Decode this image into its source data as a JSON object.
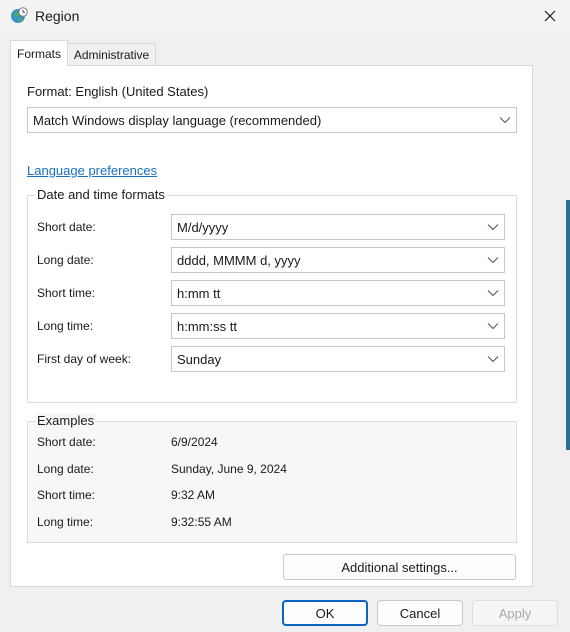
{
  "window": {
    "title": "Region"
  },
  "tabs": [
    {
      "label": "Formats",
      "active": true
    },
    {
      "label": "Administrative",
      "active": false
    }
  ],
  "format": {
    "label": "Format: English (United States)",
    "selected": "Match Windows display language (recommended)"
  },
  "language_link": "Language preferences",
  "date_time": {
    "group_title": "Date and time formats",
    "rows": [
      {
        "label": "Short date:",
        "value": "M/d/yyyy"
      },
      {
        "label": "Long date:",
        "value": "dddd, MMMM d, yyyy"
      },
      {
        "label": "Short time:",
        "value": "h:mm tt"
      },
      {
        "label": "Long time:",
        "value": "h:mm:ss tt"
      },
      {
        "label": "First day of week:",
        "value": "Sunday"
      }
    ]
  },
  "examples": {
    "group_title": "Examples",
    "rows": [
      {
        "label": "Short date:",
        "value": "6/9/2024"
      },
      {
        "label": "Long date:",
        "value": "Sunday, June 9, 2024"
      },
      {
        "label": "Short time:",
        "value": "9:32 AM"
      },
      {
        "label": "Long time:",
        "value": "9:32:55 AM"
      }
    ]
  },
  "buttons": {
    "additional_settings": "Additional settings...",
    "ok": "OK",
    "cancel": "Cancel",
    "apply": "Apply"
  },
  "icons": {
    "title_icon": "globe-clock-icon",
    "close": "close-icon",
    "dropdown": "chevron-down-icon"
  },
  "colors": {
    "link": "#1a6fc0",
    "primary_button_border": "#0a64c2",
    "disabled_text": "#a8a8a8"
  }
}
